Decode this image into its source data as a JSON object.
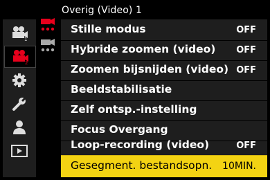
{
  "header": {
    "title": "Overig (Video) 1"
  },
  "left_tabs": [
    {
      "icon": "movie-camera-icon-1",
      "state": "normal"
    },
    {
      "icon": "movie-camera-icon-2",
      "state": "active"
    },
    {
      "icon": "gear-icon",
      "state": "normal"
    },
    {
      "icon": "wrench-icon",
      "state": "normal"
    },
    {
      "icon": "person-icon",
      "state": "normal"
    },
    {
      "icon": "playback-icon",
      "state": "normal"
    }
  ],
  "sub_tabs": [
    {
      "icon": "page-1-icon",
      "state": "active"
    },
    {
      "icon": "page-2-icon",
      "state": "normal"
    }
  ],
  "menu": {
    "items": [
      {
        "label": "Stille modus",
        "value": "OFF"
      },
      {
        "label": "Hybride zoomen (video)",
        "value": "OFF"
      },
      {
        "label": "Zoomen bijsnijden (video)",
        "value": "OFF"
      },
      {
        "label": "Beeldstabilisatie",
        "value": ""
      },
      {
        "label": "Zelf ontsp.-instelling",
        "value": ""
      },
      {
        "label": "Focus Overgang",
        "value": ""
      },
      {
        "label": "Loop-recording (video)",
        "value": "OFF"
      },
      {
        "label": "Gesegment. bestandsopn.",
        "value": "10MIN."
      }
    ],
    "selected_index": 7
  },
  "colors": {
    "accent": "#e8001c",
    "selection": "#f3d313",
    "panel": "#1e1e1e"
  }
}
